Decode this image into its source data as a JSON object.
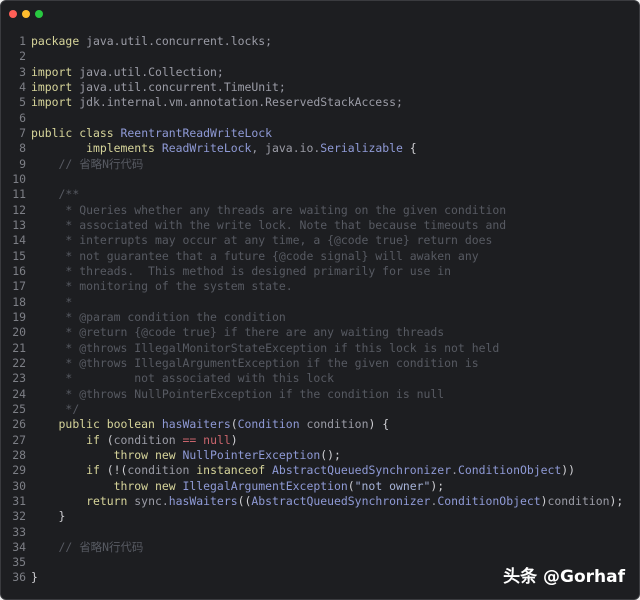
{
  "window": {
    "traffic_lights": {
      "close": "#ff5f57",
      "minimize": "#febc2e",
      "zoom": "#28c840"
    }
  },
  "watermark": "头条 @Gorhaf",
  "code_lines": [
    {
      "n": "1",
      "t": [
        [
          "kw",
          "package"
        ],
        [
          "id",
          " java.util.concurrent.locks;"
        ]
      ]
    },
    {
      "n": "2",
      "t": []
    },
    {
      "n": "3",
      "t": [
        [
          "kw",
          "import"
        ],
        [
          "id",
          " java.util.Collection;"
        ]
      ]
    },
    {
      "n": "4",
      "t": [
        [
          "kw",
          "import"
        ],
        [
          "id",
          " java.util.concurrent.TimeUnit;"
        ]
      ]
    },
    {
      "n": "5",
      "t": [
        [
          "kw",
          "import"
        ],
        [
          "id",
          " jdk.internal.vm.annotation.ReservedStackAccess;"
        ]
      ]
    },
    {
      "n": "6",
      "t": []
    },
    {
      "n": "7",
      "t": [
        [
          "kw",
          "public class "
        ],
        [
          "ty",
          "ReentrantReadWriteLock"
        ]
      ]
    },
    {
      "n": "8",
      "t": [
        [
          "kw",
          "        implements "
        ],
        [
          "ty",
          "ReadWriteLock"
        ],
        [
          "id",
          ", java.io."
        ],
        [
          "ty",
          "Serializable"
        ],
        [
          "pu",
          " {"
        ]
      ]
    },
    {
      "n": "9",
      "t": [
        [
          "cm",
          "    // 省略N行代码"
        ]
      ]
    },
    {
      "n": "10",
      "t": []
    },
    {
      "n": "11",
      "t": [
        [
          "cm",
          "    /**"
        ]
      ]
    },
    {
      "n": "12",
      "t": [
        [
          "cm",
          "     * Queries whether any threads are waiting on the given condition"
        ]
      ]
    },
    {
      "n": "13",
      "t": [
        [
          "cm",
          "     * associated with the write lock. Note that because timeouts and"
        ]
      ]
    },
    {
      "n": "14",
      "t": [
        [
          "cm",
          "     * interrupts may occur at any time, a {@code true} return does"
        ]
      ]
    },
    {
      "n": "15",
      "t": [
        [
          "cm",
          "     * not guarantee that a future {@code signal} will awaken any"
        ]
      ]
    },
    {
      "n": "16",
      "t": [
        [
          "cm",
          "     * threads.  This method is designed primarily for use in"
        ]
      ]
    },
    {
      "n": "17",
      "t": [
        [
          "cm",
          "     * monitoring of the system state."
        ]
      ]
    },
    {
      "n": "18",
      "t": [
        [
          "cm",
          "     *"
        ]
      ]
    },
    {
      "n": "19",
      "t": [
        [
          "cm",
          "     * @param condition the condition"
        ]
      ]
    },
    {
      "n": "20",
      "t": [
        [
          "cm",
          "     * @return {@code true} if there are any waiting threads"
        ]
      ]
    },
    {
      "n": "21",
      "t": [
        [
          "cm",
          "     * @throws IllegalMonitorStateException if this lock is not held"
        ]
      ]
    },
    {
      "n": "22",
      "t": [
        [
          "cm",
          "     * @throws IllegalArgumentException if the given condition is"
        ]
      ]
    },
    {
      "n": "23",
      "t": [
        [
          "cm",
          "     *         not associated with this lock"
        ]
      ]
    },
    {
      "n": "24",
      "t": [
        [
          "cm",
          "     * @throws NullPointerException if the condition is null"
        ]
      ]
    },
    {
      "n": "25",
      "t": [
        [
          "cm",
          "     */"
        ]
      ]
    },
    {
      "n": "26",
      "t": [
        [
          "kw",
          "    public boolean "
        ],
        [
          "ty",
          "hasWaiters"
        ],
        [
          "pu",
          "("
        ],
        [
          "ty",
          "Condition"
        ],
        [
          "id",
          " condition"
        ],
        [
          "pu",
          ") {"
        ]
      ]
    },
    {
      "n": "27",
      "t": [
        [
          "kw",
          "        if "
        ],
        [
          "pu",
          "("
        ],
        [
          "id",
          "condition "
        ],
        [
          "nu",
          "=="
        ],
        [
          "nu",
          " null"
        ],
        [
          "pu",
          ")"
        ]
      ]
    },
    {
      "n": "28",
      "t": [
        [
          "kw",
          "            throw new "
        ],
        [
          "ty",
          "NullPointerException"
        ],
        [
          "pu",
          "();"
        ]
      ]
    },
    {
      "n": "29",
      "t": [
        [
          "kw",
          "        if "
        ],
        [
          "pu",
          "(!("
        ],
        [
          "id",
          "condition "
        ],
        [
          "kw",
          "instanceof "
        ],
        [
          "ty",
          "AbstractQueuedSynchronizer"
        ],
        [
          "id",
          "."
        ],
        [
          "ty",
          "ConditionObject"
        ],
        [
          "pu",
          "))"
        ]
      ]
    },
    {
      "n": "30",
      "t": [
        [
          "kw",
          "            throw new "
        ],
        [
          "ty",
          "IllegalArgumentException"
        ],
        [
          "pu",
          "("
        ],
        [
          "st",
          "\"not owner\""
        ],
        [
          "pu",
          ");"
        ]
      ]
    },
    {
      "n": "31",
      "t": [
        [
          "kw",
          "        return "
        ],
        [
          "id",
          "sync."
        ],
        [
          "ty",
          "hasWaiters"
        ],
        [
          "pu",
          "(("
        ],
        [
          "ty",
          "AbstractQueuedSynchronizer"
        ],
        [
          "id",
          "."
        ],
        [
          "ty",
          "ConditionObject"
        ],
        [
          "pu",
          ")"
        ],
        [
          "id",
          "condition"
        ],
        [
          "pu",
          ");"
        ]
      ]
    },
    {
      "n": "32",
      "t": [
        [
          "pu",
          "    }"
        ]
      ]
    },
    {
      "n": "33",
      "t": []
    },
    {
      "n": "34",
      "t": [
        [
          "cm",
          "    // 省略N行代码"
        ]
      ]
    },
    {
      "n": "35",
      "t": []
    },
    {
      "n": "36",
      "t": [
        [
          "pu",
          "}"
        ]
      ]
    }
  ]
}
